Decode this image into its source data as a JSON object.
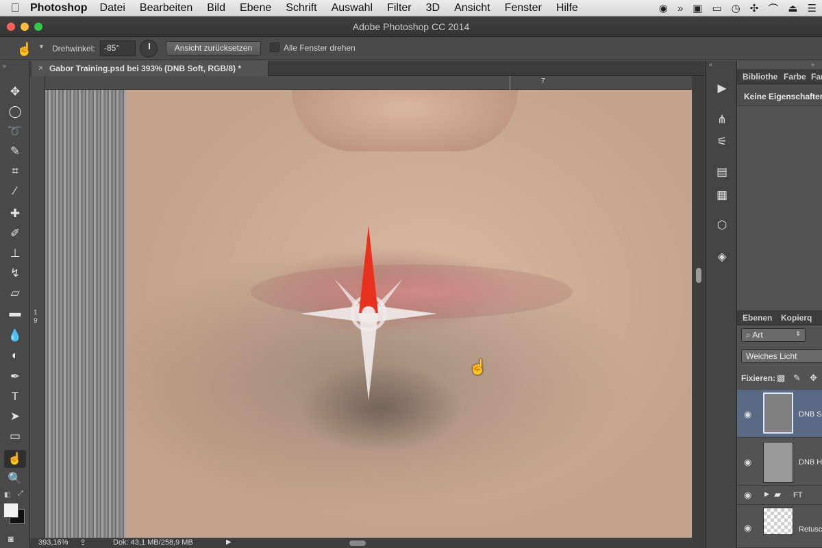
{
  "menubar": {
    "apple_icon": "",
    "app_name": "Photoshop",
    "items": [
      "Datei",
      "Bearbeiten",
      "Bild",
      "Ebene",
      "Schrift",
      "Auswahl",
      "Filter",
      "3D",
      "Ansicht",
      "Fenster",
      "Hilfe"
    ]
  },
  "window": {
    "title": "Adobe Photoshop CC 2014"
  },
  "options": {
    "rotation_label": "Drehwinkel:",
    "rotation_value": "-85°",
    "reset_view_label": "Ansicht zurücksetzen",
    "rotate_all_label": "Alle Fenster drehen"
  },
  "document": {
    "tab_title": "Gabor Training.psd bei 393% (DNB Soft, RGB/8) *"
  },
  "rulers": {
    "top_mark": "7",
    "left_mark_1": "1",
    "left_mark_2": "9"
  },
  "statusbar": {
    "zoom": "393,16%",
    "doc_size": "Dok: 43,1 MB/258,9 MB"
  },
  "properties_panel": {
    "tabs": [
      "Bibliothe",
      "Farbe",
      "Far"
    ],
    "message": "Keine Eigenschaften"
  },
  "layers_panel": {
    "tabs": [
      "Ebenen",
      "Kopierq"
    ],
    "filter_label": "⌕ Art",
    "blend_mode": "Weiches Licht",
    "lock_label": "Fixieren:",
    "layers": [
      {
        "name": "DNB S",
        "selected": true
      },
      {
        "name": "DNB H",
        "selected": false
      },
      {
        "name": "FT",
        "selected": false,
        "type": "group"
      },
      {
        "name": "Retusc",
        "selected": false
      }
    ]
  },
  "colors": {
    "accent_red": "#e8321e",
    "selected_layer": "#5a6a84"
  }
}
